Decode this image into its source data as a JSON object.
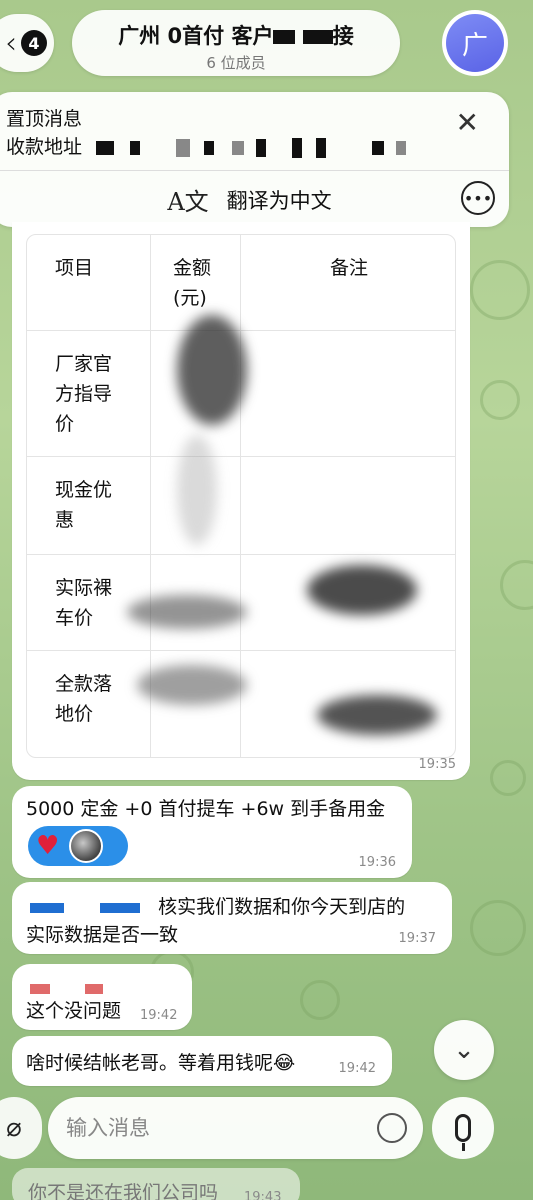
{
  "header": {
    "back_badge": "4",
    "title_a": "广州 0首付 客户",
    "title_b": "接",
    "subtitle": "6 位成员",
    "avatar_initial": "广"
  },
  "pinned": {
    "title": "置顶消息",
    "text_prefix": "收款地址",
    "translate_icon": "translate-icon",
    "translate_label": "翻译为中文"
  },
  "table_message": {
    "headers": [
      "项目",
      "金额\n(元)",
      "备注"
    ],
    "rows": [
      {
        "item": "厂家官\n方指导\n价",
        "amount": "",
        "note": ""
      },
      {
        "item": "现金优\n惠",
        "amount": "",
        "note": ""
      },
      {
        "item": "实际裸\n车价",
        "amount": "",
        "note": ""
      },
      {
        "item": "全款落\n地价",
        "amount": "",
        "note": ""
      }
    ],
    "time": "19:35"
  },
  "messages": [
    {
      "text": "5000 定金 +0 首付提车 +6w 到手备用金",
      "time": "19:36",
      "reaction": "heart"
    },
    {
      "text_line1": "核实我们数据和你今天到店的",
      "text_line2": "实际数据是否一致",
      "time": "19:37"
    },
    {
      "text": "这个没问题",
      "time": "19:42"
    },
    {
      "text": "啥时候结帐老哥。等着用钱呢😂",
      "time": "19:42"
    },
    {
      "text": "你不是还在我们公司吗",
      "time": "19:43"
    }
  ],
  "composer": {
    "placeholder": "输入消息"
  }
}
